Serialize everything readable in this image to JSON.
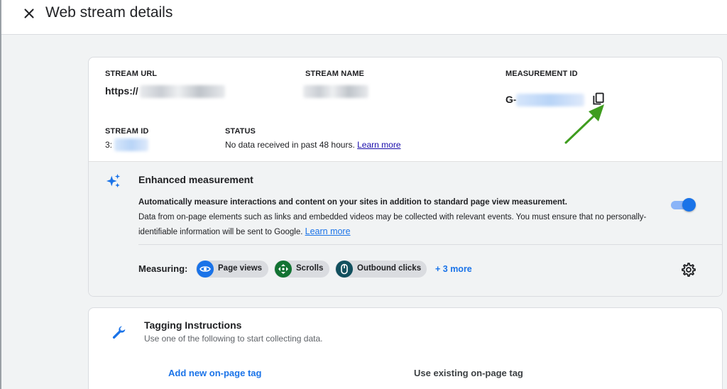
{
  "header": {
    "title": "Web stream details",
    "close_icon": "close-icon"
  },
  "stream": {
    "url_label": "STREAM URL",
    "url_value": "https://",
    "name_label": "STREAM NAME",
    "measurement_id_label": "MEASUREMENT ID",
    "measurement_id_value": "G-",
    "copy_icon": "copy-icon",
    "stream_id_label": "STREAM ID",
    "stream_id_value": "3:",
    "status_label": "STATUS",
    "status_text": "No data received in past 48 hours.",
    "status_link": "Learn more"
  },
  "enhanced": {
    "icon": "sparkle-icon",
    "title": "Enhanced measurement",
    "description_bold": "Automatically measure interactions and content on your sites in addition to standard page view measurement.",
    "description": "Data from on-page elements such as links and embedded videos may be collected with relevant events. You must ensure that no personally-identifiable information will be sent to Google.",
    "description_link": "Learn more",
    "toggle_on": true,
    "measuring_label": "Measuring:",
    "chips": [
      {
        "label": "Page views",
        "icon": "eye-icon",
        "color": "#1a73e8"
      },
      {
        "label": "Scrolls",
        "icon": "scroll-icon",
        "color": "#137333"
      },
      {
        "label": "Outbound clicks",
        "icon": "mouse-icon",
        "color": "#12505e"
      }
    ],
    "more_link": "+ 3 more",
    "settings_icon": "gear-icon"
  },
  "tagging": {
    "icon": "wrench-icon",
    "title": "Tagging Instructions",
    "subtitle": "Use one of the following to start collecting data.",
    "tab_add": "Add new on-page tag",
    "tab_existing": "Use existing on-page tag"
  },
  "colors": {
    "accent": "#1a73e8",
    "annotation_arrow": "#3f9d1f"
  }
}
